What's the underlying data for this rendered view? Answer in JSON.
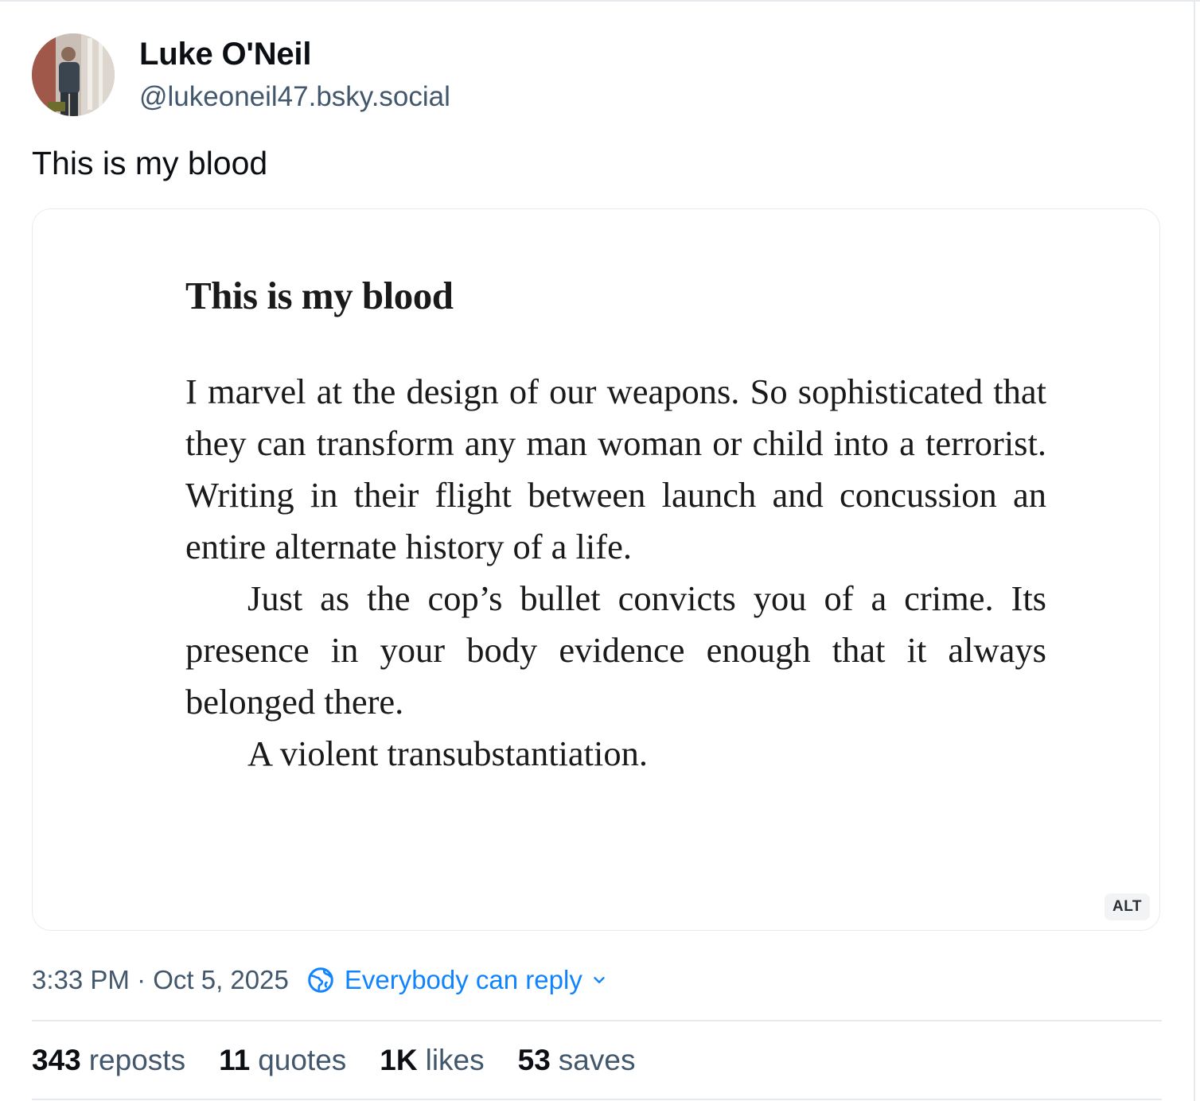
{
  "author": {
    "display_name": "Luke O'Neil",
    "handle": "@lukeoneil47.bsky.social",
    "avatar_icon": "profile-photo"
  },
  "post": {
    "text": "This is my blood",
    "image": {
      "title": "This is my blood",
      "paragraphs": [
        "I marvel at the design of our weapons. So sophisticated that they can transform any man woman or child into a terrorist. Writing in their flight between launch and concussion an entire alternate history of a life.",
        "Just as the cop’s bullet convicts you of a crime. Its presence in your body evidence enough that it always belonged there.",
        "A violent transubstantiation."
      ],
      "alt_label": "ALT"
    },
    "timestamp": "3:33 PM · Oct 5, 2025",
    "reply_setting": "Everybody can reply",
    "reply_icon": "globe-icon",
    "accent_color": "#1083fe"
  },
  "stats": [
    {
      "count": "343",
      "label": "reposts"
    },
    {
      "count": "11",
      "label": "quotes"
    },
    {
      "count": "1K",
      "label": "likes"
    },
    {
      "count": "53",
      "label": "saves"
    }
  ]
}
